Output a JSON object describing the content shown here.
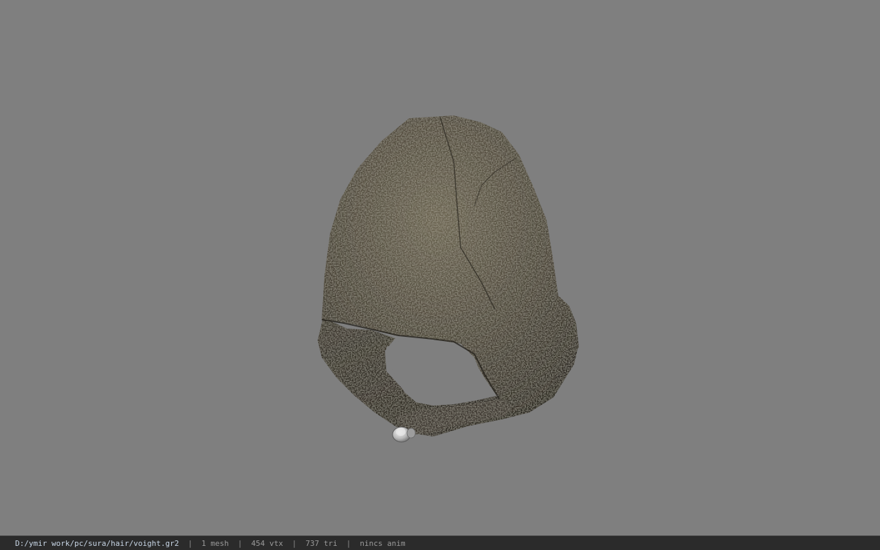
{
  "viewport": {
    "background_color": "#7f7f7f",
    "model": "hood-mesh-icon"
  },
  "status_bar": {
    "file_path": "D:/ymir work/pc/sura/hair/voight.gr2",
    "separator": "|",
    "mesh_count": "1 mesh",
    "vertex_count": "454 vtx",
    "triangle_count": "737 tri",
    "animation_status": "nincs anim"
  },
  "colors": {
    "status_bar_bg": "#2b2b2b",
    "path_text": "#c8d6e6",
    "info_text": "#9a9a9a",
    "hood_dark": "#3a352c",
    "hood_light": "#6b6452"
  }
}
